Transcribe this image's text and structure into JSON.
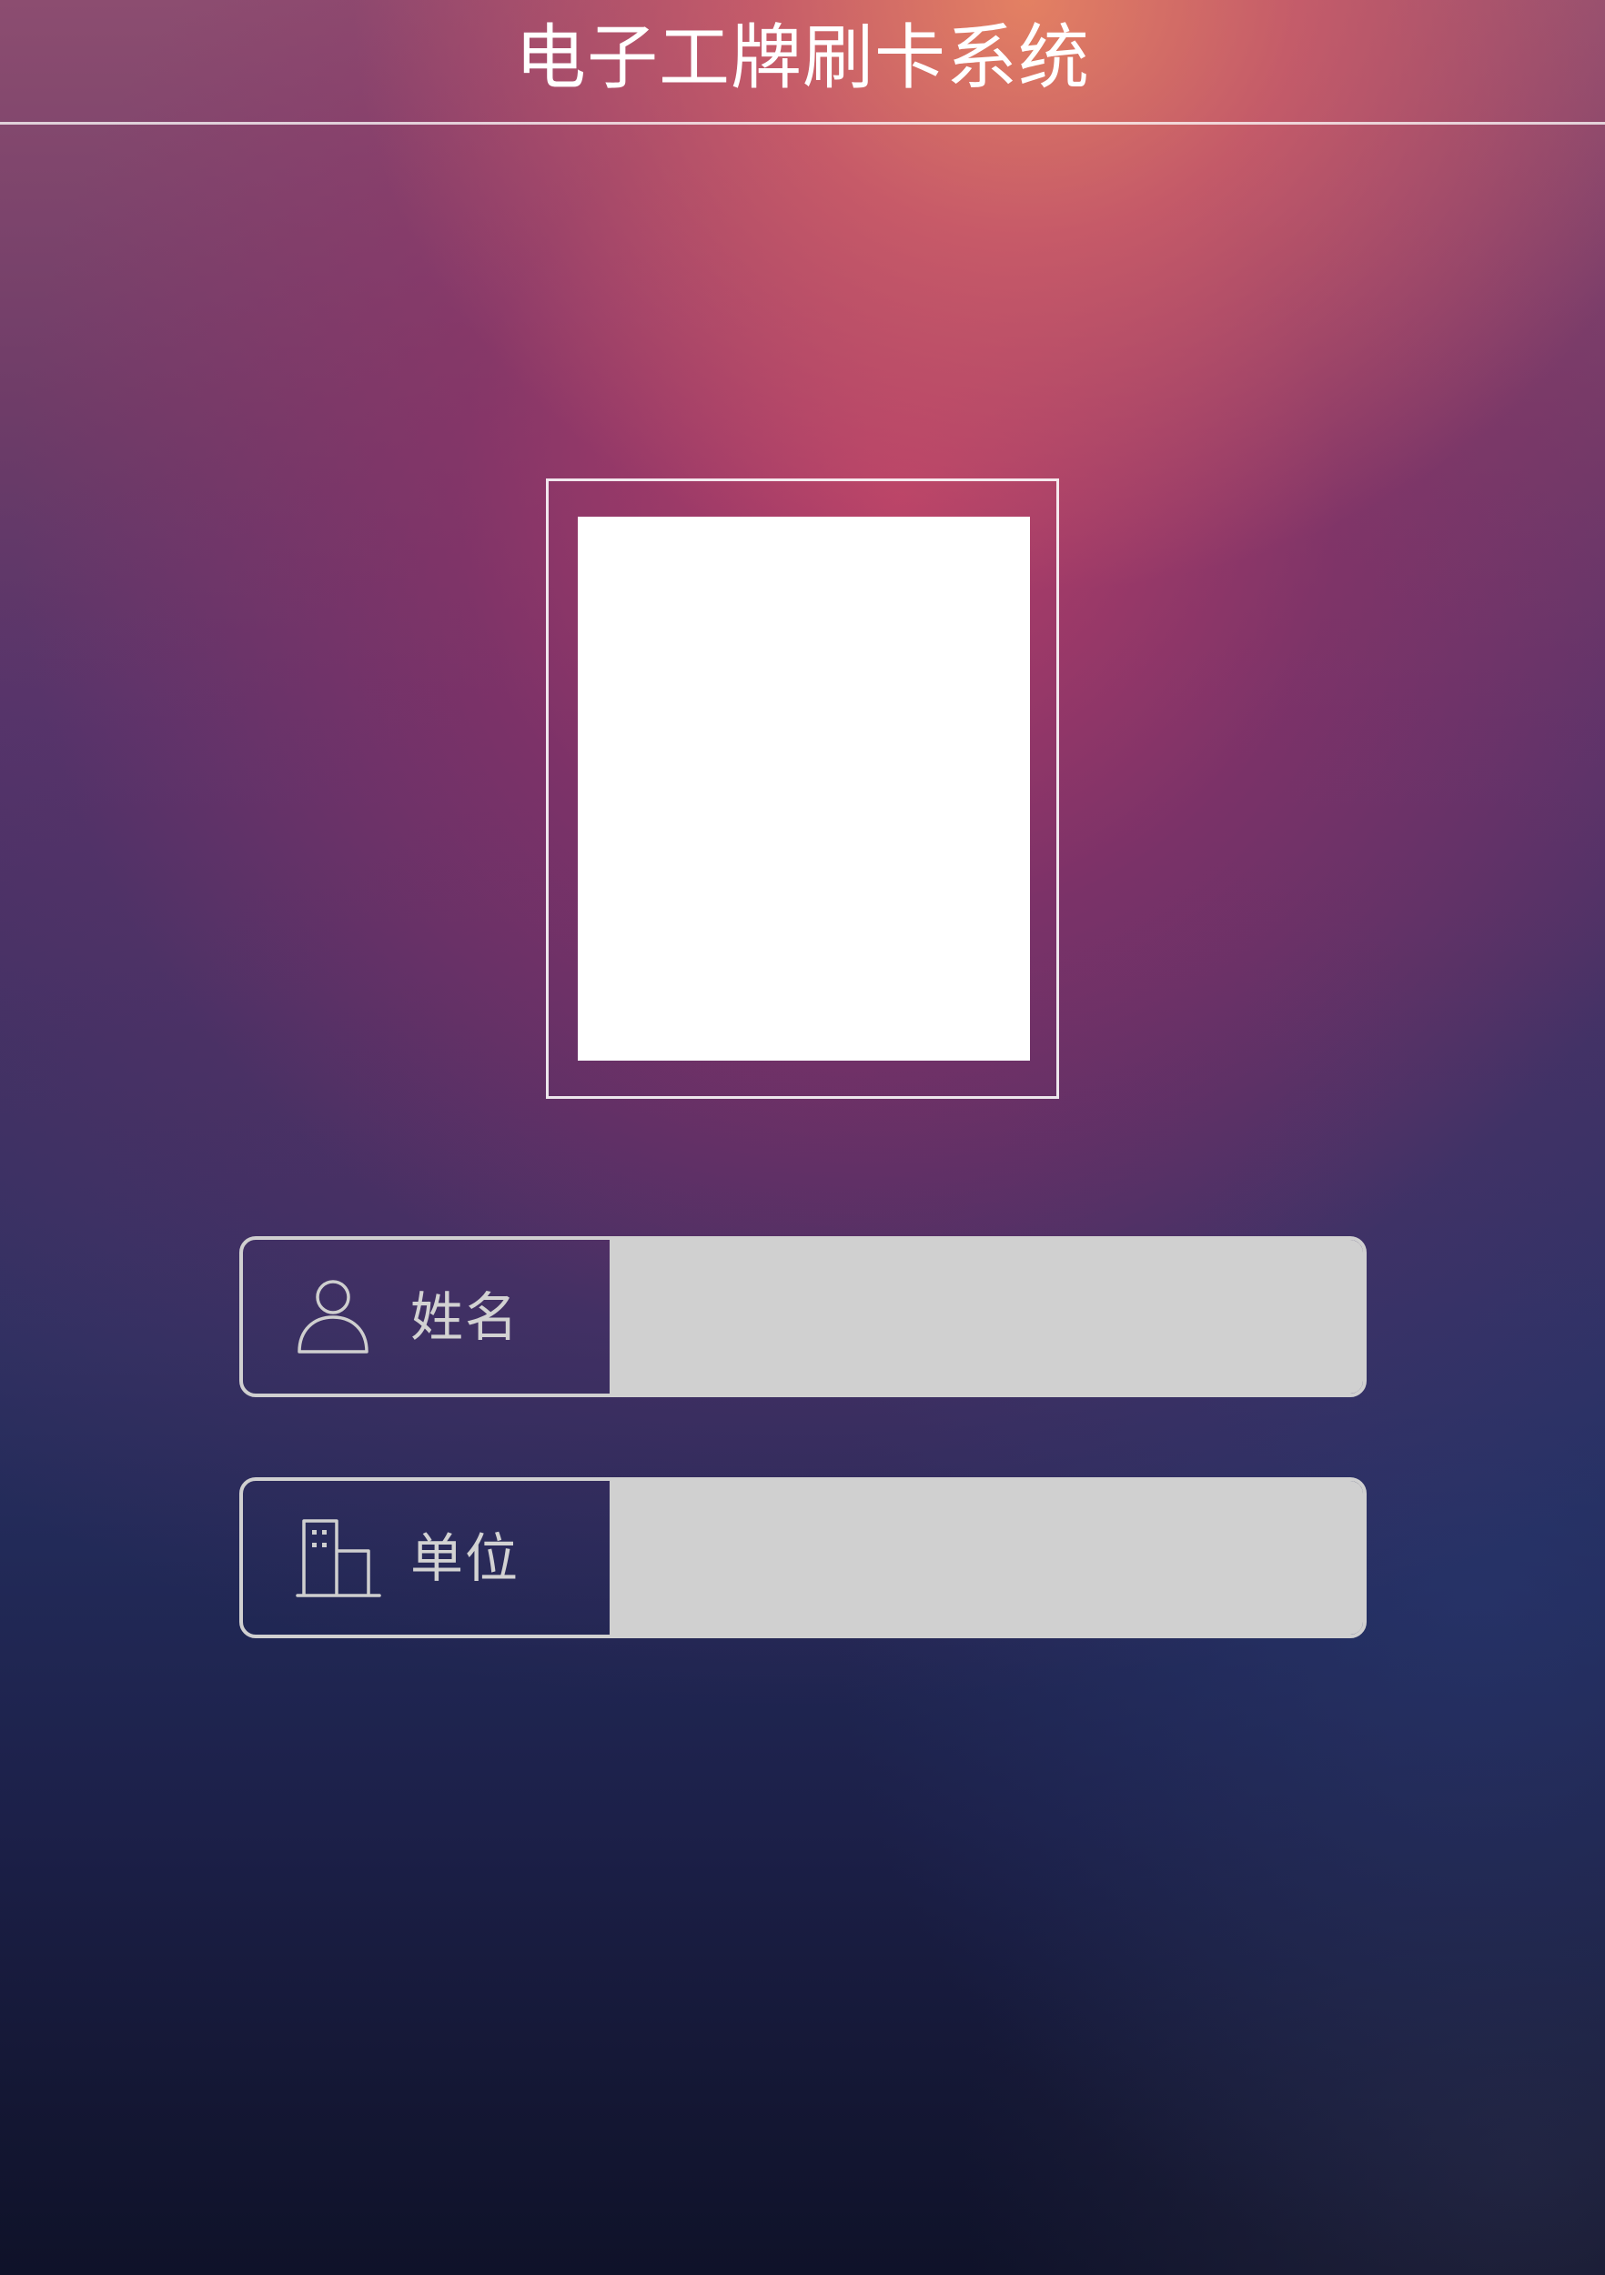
{
  "header": {
    "title": "电子工牌刷卡系统"
  },
  "photo": {
    "placeholder_icon": "photo-placeholder"
  },
  "form": {
    "name_field": {
      "label": "姓名",
      "icon": "person-icon",
      "value": ""
    },
    "unit_field": {
      "label": "单位",
      "icon": "building-icon",
      "value": ""
    }
  },
  "colors": {
    "title_text": "#ffffff",
    "label_text": "#d2d2d2",
    "field_fill": "#d0d0d0",
    "photo_fill": "#ffffff"
  }
}
